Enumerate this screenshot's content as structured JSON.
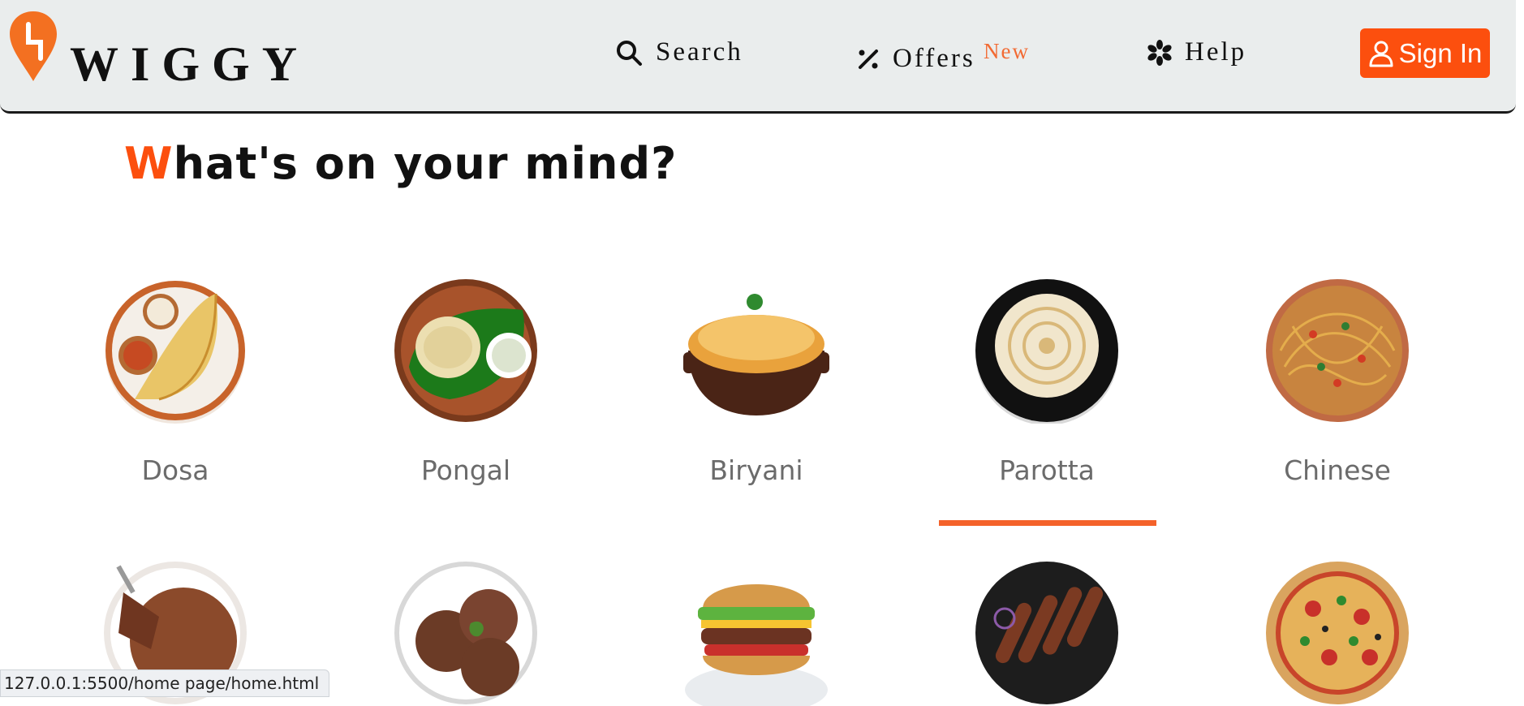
{
  "brand": {
    "logo_text": "WIGGY",
    "accent_color": "#fc4f0e"
  },
  "nav": {
    "search_label": "Search",
    "offers_label": "Offers",
    "offers_badge": "New",
    "help_label": "Help",
    "signin_label": "Sign In"
  },
  "heading": {
    "first_letter": "W",
    "rest": "hat's on your mind?"
  },
  "categories": [
    {
      "label": "Dosa",
      "icon": "dosa-image"
    },
    {
      "label": "Pongal",
      "icon": "pongal-image"
    },
    {
      "label": "Biryani",
      "icon": "biryani-image"
    },
    {
      "label": "Parotta",
      "icon": "parotta-image"
    },
    {
      "label": "Chinese",
      "icon": "chinese-image"
    },
    {
      "label": "",
      "icon": "cake-image"
    },
    {
      "label": "",
      "icon": "ice-cream-image"
    },
    {
      "label": "",
      "icon": "burger-image"
    },
    {
      "label": "",
      "icon": "kebab-image"
    },
    {
      "label": "",
      "icon": "pizza-image"
    }
  ],
  "status_bar": {
    "url": "127.0.0.1:5500/home page/home.html"
  }
}
